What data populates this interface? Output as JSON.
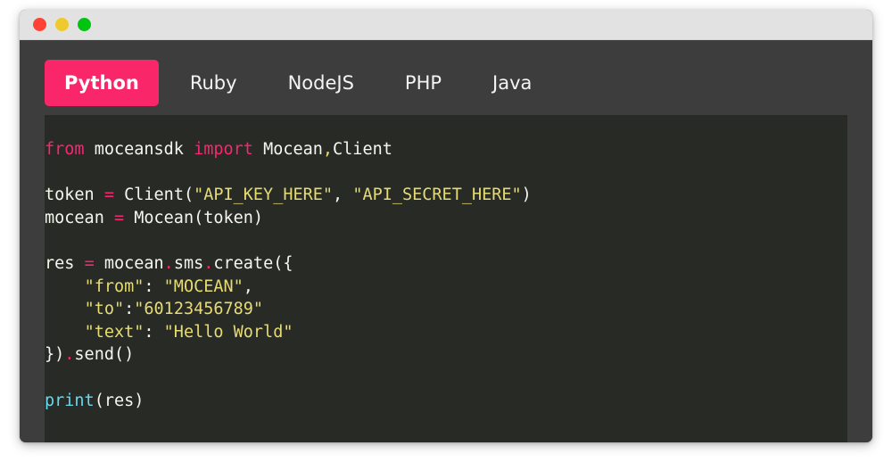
{
  "window": {
    "controls": [
      {
        "name": "close",
        "color": "#ff4136"
      },
      {
        "name": "minimize",
        "color": "#efca2f"
      },
      {
        "name": "maximize",
        "color": "#00c40f"
      }
    ],
    "chrome_color": "#e2e2e2",
    "body_color": "#3d3d3d"
  },
  "tabs": {
    "active_index": 0,
    "accent_color": "#f9276a",
    "items": [
      {
        "label": "Python"
      },
      {
        "label": "Ruby"
      },
      {
        "label": "NodeJS"
      },
      {
        "label": "PHP"
      },
      {
        "label": "Java"
      }
    ]
  },
  "code": {
    "language": "Python",
    "background_color": "#282a26",
    "plain_text": "from moceansdk import Mocean,Client\n\ntoken = Client(\"API_KEY_HERE\", \"API_SECRET_HERE\")\nmocean = Mocean(token)\n\nres = mocean.sms.create({\n    \"from\": \"MOCEAN\",\n    \"to\":\"60123456789\"\n    \"text\": \"Hello World\"\n}).send()\n\nprint(res)",
    "lines": [
      {
        "tokens": [
          {
            "t": "from",
            "c": "kw"
          },
          {
            "t": " ",
            "c": "plain"
          },
          {
            "t": "moceansdk",
            "c": "plain"
          },
          {
            "t": " ",
            "c": "plain"
          },
          {
            "t": "import",
            "c": "kw"
          },
          {
            "t": " ",
            "c": "plain"
          },
          {
            "t": "Mocean",
            "c": "plain"
          },
          {
            "t": ",",
            "c": "str"
          },
          {
            "t": "Client",
            "c": "plain"
          }
        ]
      },
      {
        "tokens": []
      },
      {
        "tokens": [
          {
            "t": "token",
            "c": "plain"
          },
          {
            "t": " ",
            "c": "plain"
          },
          {
            "t": "=",
            "c": "op"
          },
          {
            "t": " ",
            "c": "plain"
          },
          {
            "t": "Client(",
            "c": "plain"
          },
          {
            "t": "\"API_KEY_HERE\"",
            "c": "str"
          },
          {
            "t": ", ",
            "c": "plain"
          },
          {
            "t": "\"API_SECRET_HERE\"",
            "c": "str"
          },
          {
            "t": ")",
            "c": "plain"
          }
        ]
      },
      {
        "tokens": [
          {
            "t": "mocean",
            "c": "plain"
          },
          {
            "t": " ",
            "c": "plain"
          },
          {
            "t": "=",
            "c": "op"
          },
          {
            "t": " ",
            "c": "plain"
          },
          {
            "t": "Mocean(token)",
            "c": "plain"
          }
        ]
      },
      {
        "tokens": []
      },
      {
        "tokens": [
          {
            "t": "res",
            "c": "plain"
          },
          {
            "t": " ",
            "c": "plain"
          },
          {
            "t": "=",
            "c": "op"
          },
          {
            "t": " ",
            "c": "plain"
          },
          {
            "t": "mocean",
            "c": "plain"
          },
          {
            "t": ".",
            "c": "punct"
          },
          {
            "t": "sms",
            "c": "plain"
          },
          {
            "t": ".",
            "c": "punct"
          },
          {
            "t": "create({",
            "c": "plain"
          }
        ]
      },
      {
        "tokens": [
          {
            "t": "    ",
            "c": "plain"
          },
          {
            "t": "\"from\"",
            "c": "str"
          },
          {
            "t": ": ",
            "c": "plain"
          },
          {
            "t": "\"MOCEAN\"",
            "c": "str"
          },
          {
            "t": ",",
            "c": "plain"
          }
        ]
      },
      {
        "tokens": [
          {
            "t": "    ",
            "c": "plain"
          },
          {
            "t": "\"to\"",
            "c": "str"
          },
          {
            "t": ":",
            "c": "plain"
          },
          {
            "t": "\"60123456789\"",
            "c": "str"
          }
        ]
      },
      {
        "tokens": [
          {
            "t": "    ",
            "c": "plain"
          },
          {
            "t": "\"text\"",
            "c": "str"
          },
          {
            "t": ": ",
            "c": "plain"
          },
          {
            "t": "\"Hello World\"",
            "c": "str"
          }
        ]
      },
      {
        "tokens": [
          {
            "t": "})",
            "c": "plain"
          },
          {
            "t": ".",
            "c": "punct"
          },
          {
            "t": "send()",
            "c": "plain"
          }
        ]
      },
      {
        "tokens": []
      },
      {
        "tokens": [
          {
            "t": "print",
            "c": "builtin"
          },
          {
            "t": "(res)",
            "c": "plain"
          }
        ]
      }
    ]
  }
}
